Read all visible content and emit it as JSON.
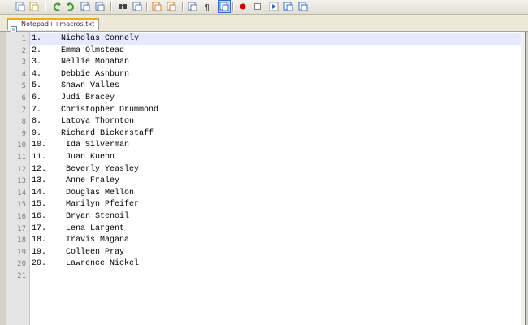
{
  "toolbar": {
    "buttons": [
      {
        "icon": "copy-icon",
        "color": "#6b8fc7"
      },
      {
        "icon": "paste-icon",
        "color": "#c8a44a"
      },
      {
        "icon": "undo-icon",
        "color": "#3a9a3a"
      },
      {
        "icon": "redo-icon",
        "color": "#3a9a3a"
      },
      {
        "icon": "sync-scroll-icon",
        "color": "#5a7ab0"
      },
      {
        "icon": "sync-horizontal-icon",
        "color": "#5a7ab0"
      },
      {
        "icon": "find-icon",
        "color": "#444444"
      },
      {
        "icon": "replace-icon",
        "color": "#5a7ab0"
      },
      {
        "icon": "zoom-in-icon",
        "color": "#d08030"
      },
      {
        "icon": "zoom-out-icon",
        "color": "#d08030"
      },
      {
        "icon": "word-wrap-icon",
        "color": "#5a7ab0"
      },
      {
        "icon": "show-all-characters-icon",
        "color": "#444444"
      },
      {
        "icon": "indent-guide-icon",
        "color": "#316ac5"
      },
      {
        "icon": "record-macro-icon",
        "color": "#cc0000"
      },
      {
        "icon": "stop-macro-icon",
        "color": "#808080"
      },
      {
        "icon": "play-macro-icon",
        "color": "#316ac5"
      },
      {
        "icon": "play-multiple-icon",
        "color": "#316ac5"
      },
      {
        "icon": "save-macro-icon",
        "color": "#316ac5"
      }
    ]
  },
  "tab": {
    "label": "Notepad++macros.txt"
  },
  "editor": {
    "line_numbers": [
      "1",
      "2",
      "3",
      "4",
      "5",
      "6",
      "7",
      "8",
      "9",
      "10",
      "11",
      "12",
      "13",
      "14",
      "15",
      "16",
      "17",
      "18",
      "19",
      "20",
      "21"
    ],
    "lines": [
      "1.    Nicholas Connely",
      "2.    Emma Olmstead",
      "3.    Nellie Monahan",
      "4.    Debbie Ashburn",
      "5.    Shawn Valles",
      "6.    Judi Bracey",
      "7.    Christopher Drummond",
      "8.    Latoya Thornton",
      "9.    Richard Bickerstaff",
      "10.    Ida Silverman",
      "11.    Juan Kuehn",
      "12.    Beverly Yeasley",
      "13.    Anne Fraley",
      "14.    Douglas Mellon",
      "15.    Marilyn Pfeifer",
      "16.    Bryan Stenoil",
      "17.    Lena Largent",
      "18.    Travis Magana",
      "19.    Colleen Pray",
      "20.    Lawrence Nickel",
      ""
    ]
  }
}
